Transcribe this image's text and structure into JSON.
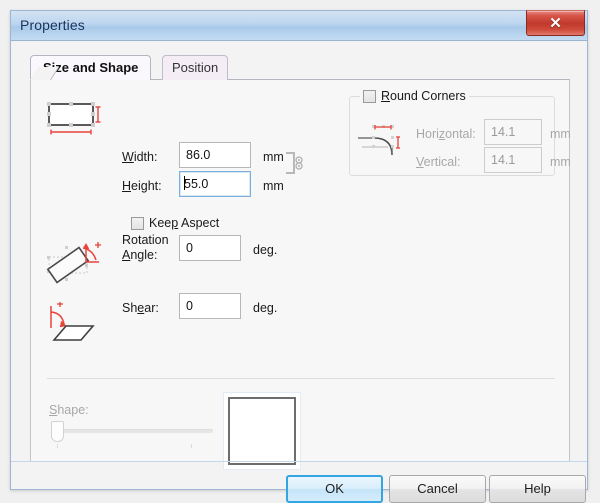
{
  "window": {
    "title": "Properties",
    "close_label": "✕"
  },
  "tabs": [
    {
      "label": "Size and Shape",
      "active": true
    },
    {
      "label": "Position",
      "active": false
    }
  ],
  "size_section": {
    "icon": "size-rectangle-icon",
    "width_label": "Width:",
    "width_mnemonic": "W",
    "width_value": "86.0",
    "width_unit": "mm",
    "height_label": "Height:",
    "height_mnemonic": "H",
    "height_value": "55.0",
    "height_unit": "mm",
    "height_focused": true,
    "link_icon": "chain-link-icon",
    "keep_aspect_label": "Keep Aspect",
    "keep_aspect_checked": false
  },
  "round_corners": {
    "title": "Round Corners",
    "checked": false,
    "enabled": false,
    "icon": "round-corner-icon",
    "horizontal_label": "Horizontal:",
    "horizontal_value": "14.1",
    "horizontal_unit": "mm",
    "vertical_label": "Vertical:",
    "vertical_value": "14.1",
    "vertical_unit": "mm"
  },
  "rotation": {
    "icon": "rotation-angle-icon",
    "label_line1": "Rotation",
    "label_line2": "Angle:",
    "value": "0",
    "unit": "deg."
  },
  "shear": {
    "icon": "shear-icon",
    "label": "Shear:",
    "value": "0",
    "unit": "deg."
  },
  "shape": {
    "label": "Shape:",
    "enabled": false,
    "slider_value": 0,
    "preview": "square-preview"
  },
  "footer": {
    "ok_label": "OK",
    "cancel_label": "Cancel",
    "help_label": "Help",
    "default_button": "OK"
  },
  "colors": {
    "titlebar": "#bcd5ef",
    "close_button": "#c0392c",
    "default_button_border": "#33a5e0",
    "focus_border": "#7aafdd",
    "icon_accent": "#e8433a"
  }
}
